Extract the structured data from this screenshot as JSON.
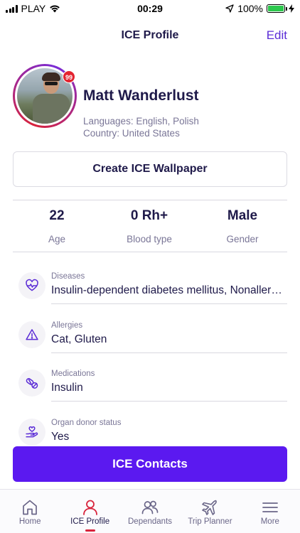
{
  "status_bar": {
    "carrier": "PLAY",
    "time": "00:29",
    "battery": "100%",
    "battery_level": 1.0
  },
  "nav": {
    "title": "ICE Profile",
    "edit_label": "Edit"
  },
  "profile": {
    "notification_badge": "99",
    "name": "Matt Wanderlust",
    "languages": "Languages: English, Polish",
    "country": "Country: United States"
  },
  "wallpaper_button": "Create ICE Wallpaper",
  "stats": [
    {
      "value": "22",
      "label": "Age"
    },
    {
      "value": "0 Rh+",
      "label": "Blood type"
    },
    {
      "value": "Male",
      "label": "Gender"
    }
  ],
  "info": [
    {
      "label": "Diseases",
      "value": "Insulin-dependent diabetes mellitus, Nonallergic rhinitis",
      "icon": "heart-pulse-icon"
    },
    {
      "label": "Allergies",
      "value": "Cat, Gluten",
      "icon": "warning-icon"
    },
    {
      "label": "Medications",
      "value": "Insulin",
      "icon": "pills-icon"
    },
    {
      "label": "Organ donor status",
      "value": "Yes",
      "icon": "donor-hand-icon"
    }
  ],
  "contacts_button": "ICE Contacts",
  "tabs": [
    {
      "label": "Home",
      "icon": "home-icon"
    },
    {
      "label": "ICE Profile",
      "icon": "profile-icon",
      "active": true
    },
    {
      "label": "Dependants",
      "icon": "dependants-icon"
    },
    {
      "label": "Trip Planner",
      "icon": "airplane-icon"
    },
    {
      "label": "More",
      "icon": "menu-icon"
    }
  ],
  "colors": {
    "accent": "#5b19f0",
    "text_dark": "#1f1a4a",
    "text_muted": "#7a7697",
    "active_tab": "#d8233b",
    "battery_fill": "#2cc84d"
  }
}
